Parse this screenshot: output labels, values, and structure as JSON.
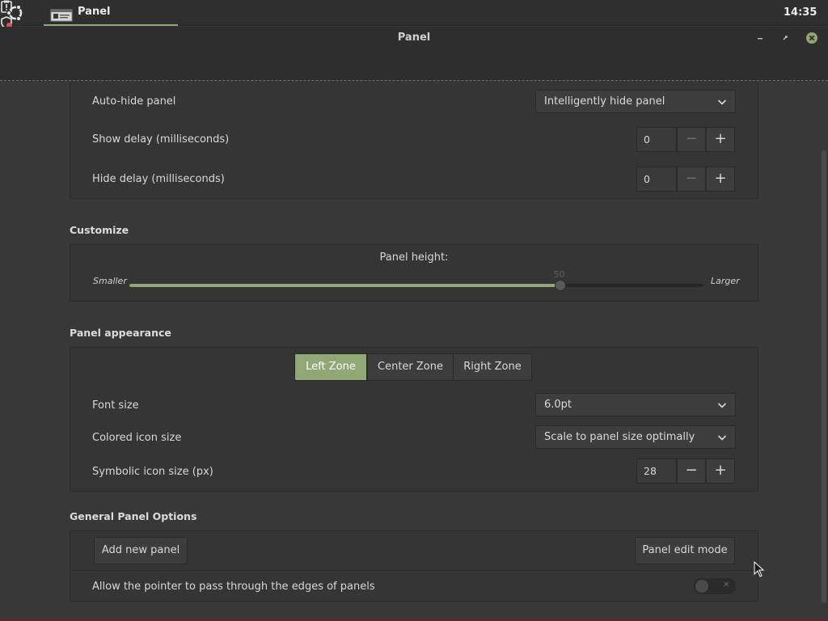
{
  "topbar": {
    "task_label": "Panel",
    "clock": "14:35"
  },
  "window": {
    "title": "Panel"
  },
  "behavior": {
    "autohide_label": "Auto-hide panel",
    "autohide_value": "Intelligently hide panel",
    "show_delay_label": "Show delay (milliseconds)",
    "show_delay_value": "0",
    "hide_delay_label": "Hide delay (milliseconds)",
    "hide_delay_value": "0"
  },
  "customize": {
    "section_title": "Customize",
    "panel_height_label": "Panel height:",
    "smaller_label": "Smaller",
    "larger_label": "Larger",
    "slider_value": "50",
    "slider_fraction": 0.75
  },
  "appearance": {
    "section_title": "Panel appearance",
    "zones": [
      "Left Zone",
      "Center Zone",
      "Right Zone"
    ],
    "active_zone": 0,
    "font_size_label": "Font size",
    "font_size_value": "6.0pt",
    "colored_icon_label": "Colored icon size",
    "colored_icon_value": "Scale to panel size optimally",
    "symbolic_icon_label": "Symbolic icon size (px)",
    "symbolic_icon_value": "28"
  },
  "general": {
    "section_title": "General Panel Options",
    "add_panel": "Add new panel",
    "edit_mode": "Panel edit mode",
    "pointer_label": "Allow the pointer to pass through the edges of panels",
    "pointer_enabled": false
  },
  "spin_symbols": {
    "minus": "−",
    "plus": "+"
  },
  "colors": {
    "accent": "#8fa876",
    "close": "#8fa876",
    "background": "#383838"
  },
  "icons": {
    "menu": "ubuntu-logo-icon",
    "task": "window-icon",
    "tray": [
      "clipboard-icon",
      "shield-update-icon",
      "network-icon",
      "volume-icon"
    ],
    "window": [
      "minimize-icon",
      "restore-icon",
      "close-icon"
    ]
  }
}
